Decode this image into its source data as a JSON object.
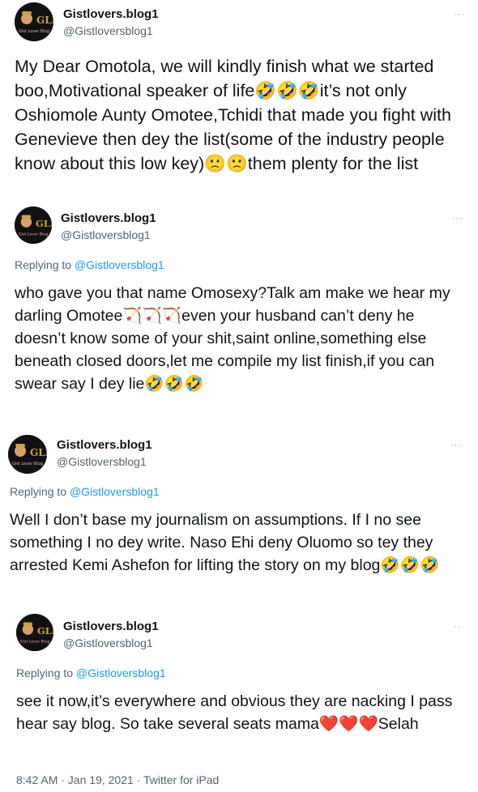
{
  "tweets": [
    {
      "name": "Gistlovers.blog1",
      "handle": "@Gistloversblog1",
      "more": "···",
      "text": "My Dear Omotola, we will kindly finish what we started boo,Motivational speaker of life🤣🤣🤣it’s not only Oshiomole Aunty Omotee,Tchidi that made you fight with Genevieve then dey the list(some of the industry people know about this low key)🙁🙁them plenty for the list"
    },
    {
      "name": "Gistlovers.blog1",
      "handle": "@Gistloversblog1",
      "more": "···",
      "replying_prefix": "Replying to ",
      "replying_to": "@Gistloversblog1",
      "text": "who gave you that name Omosexy?Talk am make we hear my darling Omotee🏹🏹🏹even your husband can’t deny he doesn’t know some of your shit,saint online,something else beneath closed doors,let me compile my list finish,if you can swear say I dey lie🤣🤣🤣"
    },
    {
      "name": "Gistlovers.blog1",
      "handle": "@Gistloversblog1",
      "more": "···",
      "replying_prefix": "Replying to ",
      "replying_to": "@Gistloversblog1",
      "text": "Well I don’t base my journalism on assumptions. If I no see something I no dey write. Naso Ehi deny Oluomo so tey they arrested Kemi Ashefon for lifting the story on my blog🤣🤣🤣"
    },
    {
      "name": "Gistlovers.blog1",
      "handle": "@Gistloversblog1",
      "more": "··",
      "replying_prefix": "Replying to ",
      "replying_to": "@Gistloversblog1",
      "text": "see it now,it’s everywhere and obvious they are nacking I pass hear say blog. So take several seats mama❤️❤️❤️Selah"
    }
  ],
  "footer": {
    "timestamp": "8:42 AM · Jan 19, 2021 · Twitter for iPad"
  },
  "avatar_logo": {
    "letters": "GLB",
    "caption": "Gist Lover Blog",
    "colors": {
      "bg": "#111111",
      "letters": "#c9a23a",
      "face": "#d6a06a",
      "caption": "#e8a6c6"
    }
  }
}
